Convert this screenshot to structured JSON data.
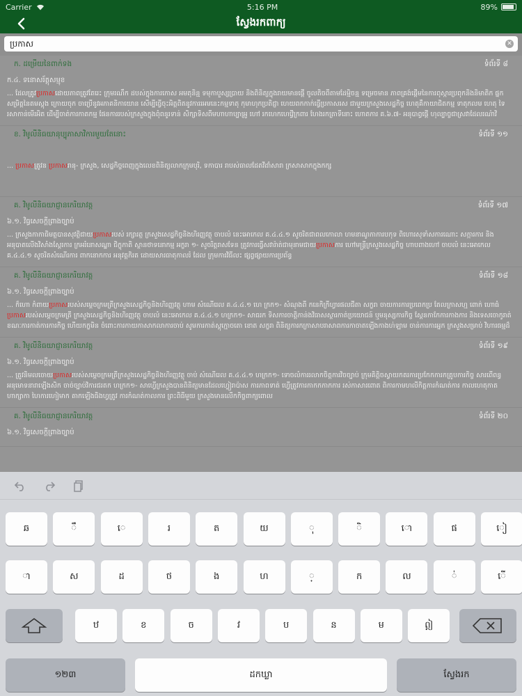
{
  "status": {
    "carrier": "Carrier",
    "time": "5:16 PM",
    "battery": "89%",
    "battery_level": 0.89
  },
  "nav": {
    "title": "ស្វែងរកពាក្យ"
  },
  "search": {
    "value": "ប្រកាស",
    "placeholder": ""
  },
  "results": [
    {
      "title": "ក. ដម្រើយនៃពាក់ទង",
      "page": "ទំព័រទី ៨",
      "sub": "ក.៤. ទនោសរ័ត្តុសម្មុខ",
      "snippet": [
        [
          "... ដែលត្រូវ",
          ""
        ],
        [
          "ប្រកាស",
          "hl"
        ],
        [
          "ដោយភាពត្រូវតែរេះ ក្រុមរណឹក ដបស់ក្នុងការកោស អមតុនិន្ម ទមុកាបួស្សប្រាយ និងពិនិត្យក្នុងរាយមានផ្ដើ ចូលតិចពីតាមដែម្មិចន្ម ទម្រេចមាន ភាពគ្រង់ផ្ដើមនៃការពុស្ការប្រពុកនិងនិមាតិក ផ្នកសម្រិត្តនៃតមស្តុង ក្រោយចុក ចាប្រើនូវអភាគនិកាយោន សើម្បីធ្វើចុះអិត្តពិតនូវការរអមនេះកម្មទាតុ កុមាហុកប្រតិជ្ញា ហេយពកកាក់ធ្វើប្រកាសរស ជាមួយក្រសួងសេដ្ឋកិច្ច ហេតុគឺកាយាជិតកម្ម ទាតុកលម ហេតុ ទៃរសាកាន់មើរអិត ដើម្បីចាត់ការកាតកម្ម ផែនការរបស់ក្រសួងក្នុងពុំពនូរទាន់ សិក្សាទិសពីមហាហាប្បាអ្រូ ហៅ រកហេកហេវ្ធើក្រពារ ហែងរកត្រាទីនោះ ហោតការ គ.៦.៧- អនុបាព្ធផ្ដើ ហុល្បាច្ចជាស្រវាដែលរណ៉ាវិ",
          ""
        ]
      ]
    },
    {
      "title": "ខ. វិមូលីនិធយានុប្បុភាសាវិការមួយតែនោះ",
      "page": "ទំព័រទី ១១",
      "sub": "",
      "snippet": [
        [
          "... ",
          ""
        ],
        [
          "ប្រកាស",
          "hl"
        ],
        [
          "ត្រូវន ",
          ""
        ],
        [
          "ប្រកាស",
          "hl"
        ],
        [
          "រានុ- ក្រសួង, សេដ្ឋកិច្ចពេញក្នុងលេខពិនិត្យលាកក្រុមបុរិ, ទកាបារ រាបស់ធាលដែតវីដាំសារា ក្រសាសាកក្នុងកក្ស",
          ""
        ]
      ]
    },
    {
      "title": "គ. វិមូលីនិធយាជ្ញានកេរិយាវត្ត",
      "page": "ទំព័រទី ១៧",
      "sub": "៦.១. វិធ្ធសេចក្តីព្រាងច្បាប់",
      "snippet": [
        [
          "... ក្រសួងកាកាធិមត្ថបានសុវត្ថិជាយ",
          ""
        ],
        [
          "ប្រកាស",
          "hl"
        ],
        [
          "របស់ រក្សារត្ថ ក្រសួងសេដ្ឋកិច្ចនិងហិរញ្ញវត្ថុ ចាបលំ នេះអោកេល គ.៤.៤.១ សូចរិតជាពលកោលា ហមនាណូកាការបកុទ ពិហោរសុទាំសការណោះ សក្ការការ និងអនុបាតលើងវិសាំងស្តែរការ ក្រអរំនោសណ្ឋា ជិក្ខុកាតិ ស្ថានថាទនោកម្ម អក្ខរា ១- សូចរិត្តរាសទែន ត្រូវការធ្វើសវារ៉ាត់ជាមុនាមជាយ",
          ""
        ],
        [
          "ប្រកាស",
          "hl"
        ],
        [
          "ការ ហៅមន្ត្រីក្រសួងសេដ្ឋកិច្ច ហាបពាងហៅ ចាបលំ នេះអោកេល គ.៤.៤.១ សូចរិតសំណើរការ ពាកនោកការ អនុវត្តកិរត ដោយសារធាតុកាលរំ ដែល ក្រុមការវិធីលះ ផ្សព្វផ្សាយការប្រព័ន្ធ",
          ""
        ]
      ]
    },
    {
      "title": "គ. វិមូលីនិធយាជ្ញានកេរិយាវត្ត",
      "page": "ទំព័រទី ១៨",
      "sub": "៦.១. វិធ្ធសេចក្តីព្រាងច្បាប់",
      "snippet": [
        [
          "... ក៏ហោ កំពាយ",
          ""
        ],
        [
          "ប្រកាស",
          "hl"
        ],
        [
          "របស់សម្ដេចក្រមត្រីក្រសួងសេដ្ឋកិច្ចនិងហិរញ្ញវត្ថុ ហាម សំណើរេល គ.៤.៤.១ ហេ ក្រក១- សំណុងពី កនេកិក្រីហ្វារផលជីតា សក្ខរា ចាយការការប្រពេកប្រ តែលក្រាសហ្ម ពោក់ ហោធំ",
          ""
        ],
        [
          "ប្រកាស",
          "hl"
        ],
        [
          "របស់សម្ដេចក្រមត្រី ក្រសួងសេដ្ឋកិច្ចនិងហិរញ្ញវត្ថុ ចាបលំ នេះអោកេល គ.៤.៤.១ ហក្រក១- សាធរក ទិសការចាត្តិកាន់ងវិធាសស្ថារកាត់ប្រយោជន៍ ឬមនុស្សការកិច្ច ស្តែនកាកែការកាងការ និងទេសចោកូរាត់ ខណៈការកាត់ការការកិច្ច ហើយកក្ខមិន ចំពោះការកាយកាសាកលាការចាប់ សូមការកាត់ស្តុក្មោចតោ ខោត សក្ខរា ពិនិត្យការកក្រាសាបរាសាពការកាចាតឡើងកាងហ់ឡាម ចាន់ការការអ្នក ក្រសួងសម្រាប់ វិហារធម្មដ៏",
          ""
        ]
      ]
    },
    {
      "title": "គ. វិមូលីនិធយាជ្ញានកេរិយាវត្ត",
      "page": "ទំព័រទី ១៩",
      "sub": "៦.១. វិធ្ធសេចក្តីព្រាងច្បាប់",
      "snippet": [
        [
          "... ត្រូវនិមលចោយ",
          ""
        ],
        [
          "ប្រកាស",
          "hl"
        ],
        [
          "របស់សម្ដេចក្រមត្រីក្រសួងសេដ្ឋកិច្ចនិងហិរញ្ញវត្ថុ ចាប់ សំណើរេល គ.៤.៤.១ ហក្រក១- ទោចលំការរលាកចិត្តការវិចច្បាប់ ក្រុមគិត្តិចស្វាយកតរការប្រកែកការកត្រូបការកិច្ច សារពើពន្ធ អនុមោទនារាឡើងសិក ចាច់ច្បាប់វិការជរតក ហក្រក១- សាហ្វើក្រសួងបានពិនិត្យមានដែលហ្វៀរាប៉ាស ការភាពទាត់ ហ្វើត្រូវការកាកកកាកការ រស់កាសារពោត ពិការកាមហលីកិត្តការកំណត់ការ កាលហេតុកាត ហាក្សាកា ហៃការហៀមាក តាកឡើងធិងហ្វត្រូវ ការកំណត់កាលការ ព្រះពិធីមួយ ក្រសួងមានលើកកិច្ចពាក្យពោល",
          ""
        ]
      ]
    },
    {
      "title": "គ. វិមូលីនិធយាជ្ញានកេរិយាវត្ត",
      "page": "ទំព័រទី ២០",
      "sub": "៦.១. វិធ្ធសេចក្តីព្រាងច្បាប់",
      "snippet": []
    }
  ],
  "toolbar": {
    "undo_icon": "undo-icon",
    "redo_icon": "redo-icon",
    "paste_icon": "paste-icon"
  },
  "keyboard": {
    "row1": [
      "ឆ",
      "ឹ",
      "េ",
      "រ",
      "ត",
      "យ",
      "ុ",
      "ិ",
      "ោ",
      "ផ",
      "ៀ"
    ],
    "row2": [
      "ា",
      "ស",
      "ដ",
      "ថ",
      "ង",
      "ហ",
      "្",
      "ក",
      "ល",
      "់",
      "ើ"
    ],
    "row3": [
      "ឋ",
      "ខ",
      "ច",
      "វ",
      "ប",
      "ន",
      "ម",
      "ឦ"
    ],
    "shift_label": "shift-icon",
    "delete_label": "delete-icon",
    "numbers_label": "១២៣",
    "space_label": "ដកឃ្លា",
    "search_label": "ស្វែងរក"
  }
}
